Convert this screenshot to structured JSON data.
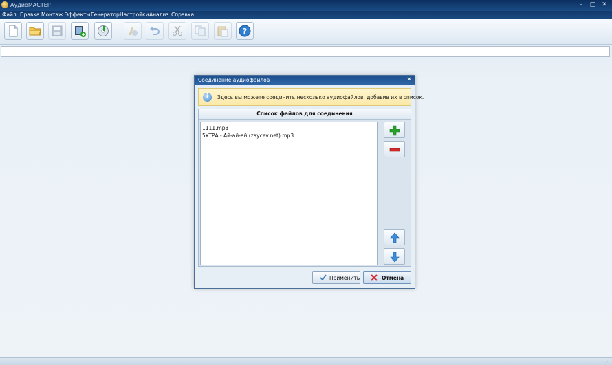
{
  "window": {
    "title": "АудиоМАСТЕР"
  },
  "menu": [
    "Файл",
    "Правка",
    "Монтаж",
    "Эффекты",
    "Генератор",
    "Настройки",
    "Анализ",
    "Справка"
  ],
  "dialog": {
    "title": "Соединение аудиофайлов",
    "info_text": "Здесь вы можете соединить несколько аудиофайлов, добавив их в список.",
    "list_header": "Список файлов для соединения",
    "files": [
      "1111.mp3",
      "5УТРА - Ай-ай-ай (zaycev.net).mp3"
    ],
    "apply_label": "Применить",
    "cancel_label": "Отмена"
  },
  "toolbar_icons": [
    "new-file-icon",
    "open-folder-icon",
    "save-icon",
    "add-video-icon",
    "cd-burn-icon",
    "audio-edit-icon",
    "undo-icon",
    "cut-icon",
    "copy-icon",
    "paste-icon",
    "help-icon"
  ],
  "colors": {
    "titlebar": "#0c2f5f",
    "accent_green": "#2aa12a",
    "accent_red": "#d22b2b",
    "accent_blue": "#2f7fd0"
  }
}
